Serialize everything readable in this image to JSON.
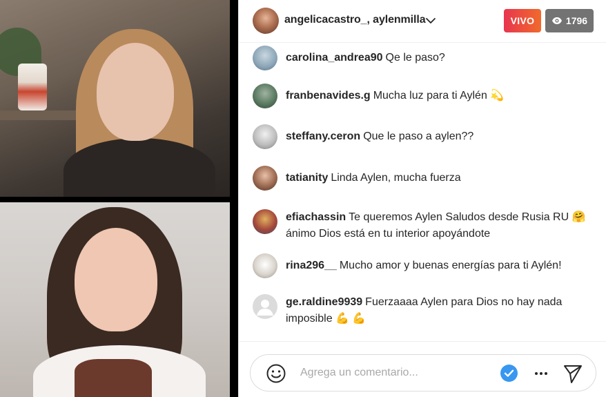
{
  "header": {
    "host_names": "angelicacastro_, aylenmilla",
    "live_label": "VIVO",
    "viewer_count": "1796"
  },
  "comments": [
    {
      "user": "carolina_andrea90",
      "text": "Qe le paso?"
    },
    {
      "user": "franbenavides.g",
      "text": "Mucha luz para ti Aylén 💫"
    },
    {
      "user": "steffany.ceron",
      "text": "Que le paso a aylen??"
    },
    {
      "user": "tatianity",
      "text": "Linda Aylen, mucha fuerza"
    },
    {
      "user": "efiachassin",
      "text": "Te queremos Aylen Saludos desde Rusia RU 🤗 ánimo Dios está en tu interior apoyándote"
    },
    {
      "user": "rina296__",
      "text": "Mucho amor y buenas energías para ti Aylén!"
    },
    {
      "user": "ge.raldine9939",
      "text": "Fuerzaaaa Aylen para Dios no hay nada imposible 💪 💪"
    }
  ],
  "input": {
    "placeholder": "Agrega un comentario..."
  },
  "colors": {
    "live_gradient_start": "#e8364f",
    "live_gradient_end": "#f06a2c",
    "viewer_badge": "#737373",
    "accent_blue": "#3897f0"
  },
  "icons": {
    "dropdown": "chevron-down-icon",
    "viewers": "eye-icon",
    "emoji": "smiley-icon",
    "verify": "check-circle-icon",
    "more": "ellipsis-icon",
    "send": "send-icon"
  }
}
